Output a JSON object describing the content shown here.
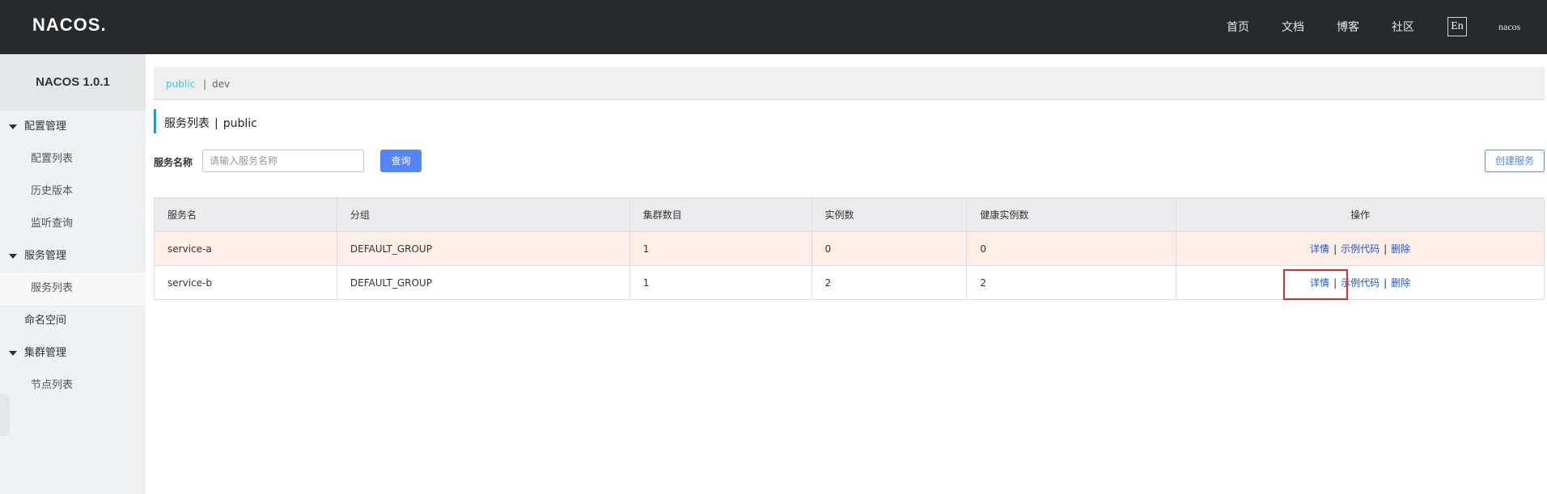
{
  "header": {
    "logo": "NACOS.",
    "nav": [
      "首页",
      "文档",
      "博客",
      "社区"
    ],
    "lang": "En",
    "user": "nacos"
  },
  "sidebar": {
    "title": "NACOS 1.0.1",
    "groups": [
      {
        "label": "配置管理",
        "items": [
          "配置列表",
          "历史版本",
          "监听查询"
        ]
      },
      {
        "label": "服务管理",
        "items": [
          "服务列表"
        ]
      },
      {
        "label": "命名空间"
      },
      {
        "label": "集群管理",
        "items": [
          "节点列表"
        ]
      }
    ],
    "active_item": "服务列表"
  },
  "namespaces": {
    "active": "public",
    "separator": "|",
    "other": "dev"
  },
  "page": {
    "title": "服务列表",
    "separator": "|",
    "namespace": "public"
  },
  "search": {
    "label": "服务名称",
    "placeholder": "请输入服务名称",
    "value": "",
    "query_button": "查询",
    "create_button": "创建服务"
  },
  "table": {
    "columns": [
      "服务名",
      "分组",
      "集群数目",
      "实例数",
      "健康实例数",
      "操作"
    ],
    "rows": [
      {
        "name": "service-a",
        "group": "DEFAULT_GROUP",
        "clusters": "1",
        "instances": "0",
        "healthy": "0"
      },
      {
        "name": "service-b",
        "group": "DEFAULT_GROUP",
        "clusters": "1",
        "instances": "2",
        "healthy": "2"
      }
    ],
    "actions": [
      "详情",
      "示例代码",
      "删除"
    ],
    "action_separator": "|"
  },
  "colors": {
    "topbar": "#252a2f",
    "accent": "#5584ff",
    "namespace_active": "#33cde5",
    "link": "#1a56d6",
    "highlight_row": "#fdeee7",
    "annotation": "#e02b2b"
  }
}
